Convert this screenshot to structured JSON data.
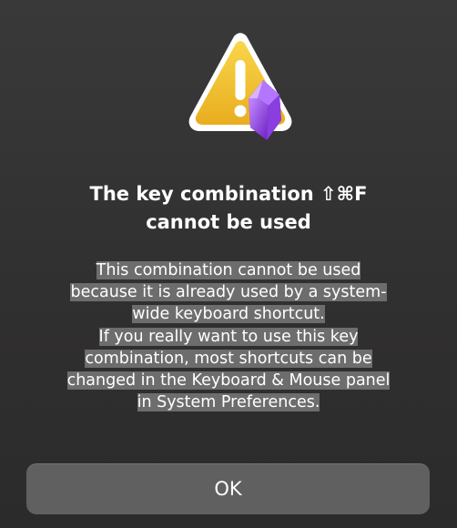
{
  "dialog": {
    "icon": "warning-triangle-icon",
    "badge_icon": "obsidian-crystal-icon",
    "title_lines": [
      "The key combination ⇧⌘F",
      "cannot be used"
    ],
    "message_lines": [
      "This combination cannot be used",
      "because it is already used by a system-",
      "wide keyboard shortcut.",
      "If you really want to use this key",
      "combination, most shortcuts can be",
      "changed in the Keyboard & Mouse panel",
      "in System Preferences."
    ],
    "ok_label": "OK"
  },
  "colors": {
    "background": "#333232",
    "warning_yellow": "#f2c230",
    "badge_purple": "#8b3fd9",
    "selection_highlight": "#6e6d6d",
    "button": "#616060"
  }
}
